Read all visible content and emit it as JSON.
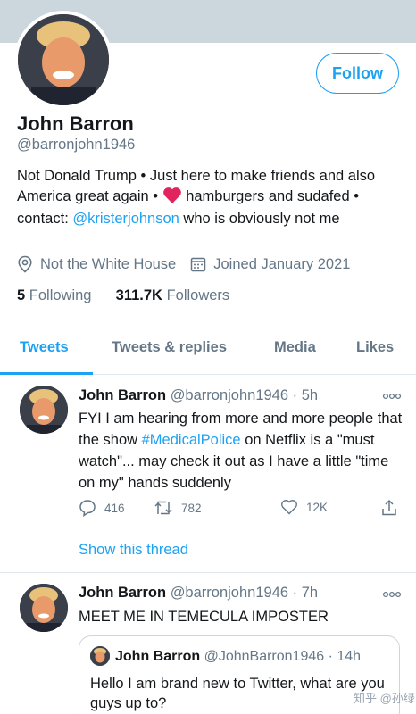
{
  "profile": {
    "name": "John Barron",
    "handle": "@barronjohn1946",
    "follow_label": "Follow",
    "bio": {
      "line1_a": "Not Donald Trump • Just here to make friends and also America great again • ",
      "line1_b": " hamburgers and sudafed • contact: ",
      "mention": "@kristerjohnson",
      "line1_c": " who is obviously not me"
    },
    "location": "Not the White House",
    "joined": "Joined January 2021",
    "following_count": "5",
    "following_label": "Following",
    "followers_count": "311.7K",
    "followers_label": "Followers"
  },
  "tabs": [
    {
      "label": "Tweets"
    },
    {
      "label": "Tweets & replies"
    },
    {
      "label": "Media"
    },
    {
      "label": "Likes"
    }
  ],
  "tweets": [
    {
      "name": "John Barron",
      "handle": "@barronjohn1946",
      "time": "· 5h",
      "text_a": "FYI I am hearing from more and more people that the show ",
      "hashtag": "#MedicalPolice",
      "text_b": " on Netflix is a \"must watch\"... may check it out as I have a little \"time on my\" hands suddenly",
      "replies": "416",
      "retweets": "782",
      "likes": "12K",
      "thread_label": "Show this thread"
    },
    {
      "name": "John Barron",
      "handle": "@barronjohn1946",
      "time": "· 7h",
      "text": "MEET ME IN TEMECULA IMPOSTER",
      "quote": {
        "name": "John Barron",
        "handle": "@JohnBarron1946",
        "time": "· 14h",
        "text": "Hello I am brand new to Twitter, what are you guys up to?"
      }
    }
  ],
  "watermark": "知乎 @孙绿",
  "colors": {
    "accent": "#1da1f2",
    "secondary_text": "#657786",
    "heart": "#e0245e",
    "banner": "#ccd6dd"
  }
}
